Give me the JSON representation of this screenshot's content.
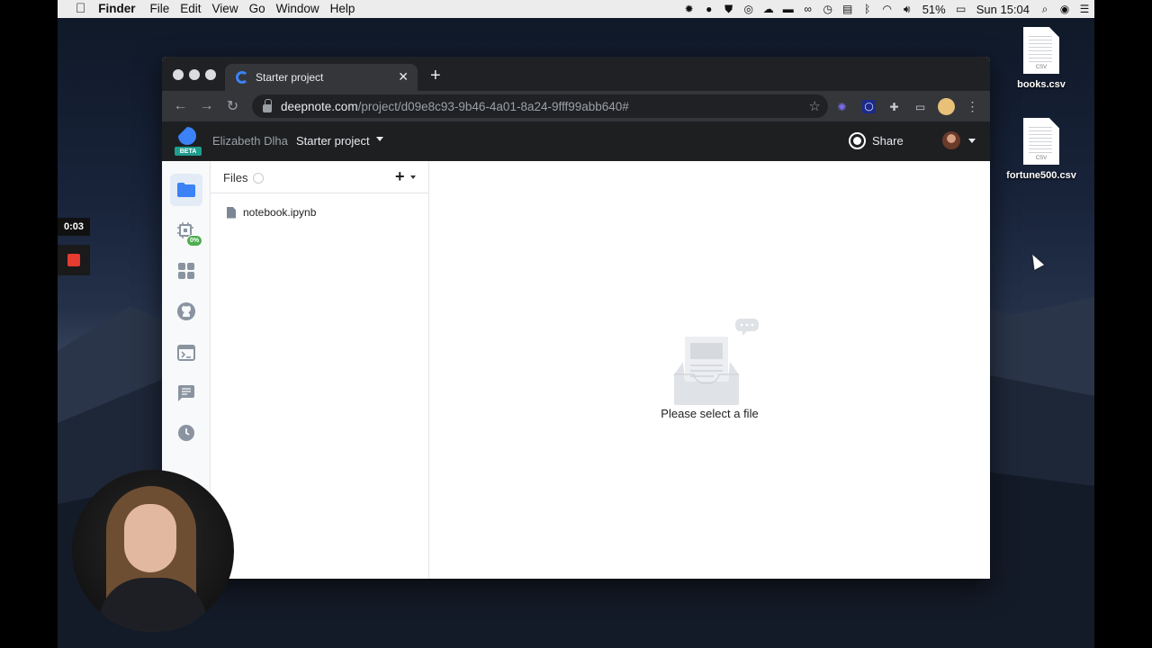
{
  "menubar": {
    "apple_icon": "apple-icon",
    "app_name": "Finder",
    "menus": [
      "File",
      "Edit",
      "View",
      "Go",
      "Window",
      "Help"
    ],
    "battery": "51%",
    "clock": "Sun 15:04"
  },
  "desktop": {
    "files": [
      {
        "name": "books.csv",
        "type": "CSV"
      },
      {
        "name": "fortune500.csv",
        "type": "CSV"
      }
    ]
  },
  "recorder": {
    "time": "0:03"
  },
  "browser": {
    "tab_title": "Starter project",
    "url_host": "deepnote.com",
    "url_path": "/project/d09e8c93-9b46-4a01-8a24-9fff99abb640#"
  },
  "app": {
    "beta_label": "BETA",
    "owner": "Elizabeth Dlha",
    "project": "Starter project",
    "share_label": "Share",
    "badge": "0%",
    "files_label": "Files",
    "files": [
      {
        "name": "notebook.ipynb"
      }
    ],
    "empty_message": "Please select a file"
  },
  "colors": {
    "accent": "#3b82f6",
    "stop": "#e53b30",
    "badge": "#4caf50"
  }
}
